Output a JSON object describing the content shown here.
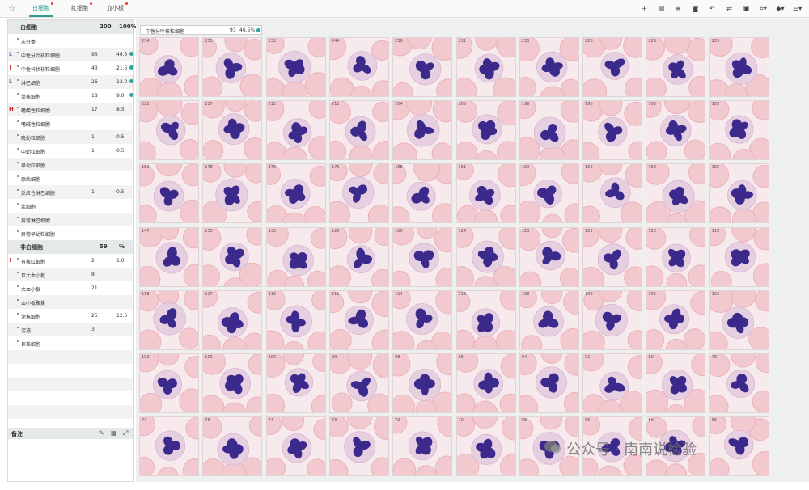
{
  "tabs": [
    {
      "label": "白细胞",
      "active": true
    },
    {
      "label": "红细胞",
      "active": false
    },
    {
      "label": "血小板",
      "active": false
    }
  ],
  "toolbar_icons": [
    "add-icon",
    "copy-icon",
    "sort-icon",
    "camera-icon",
    "undo-icon",
    "compare-icon",
    "bookmark-icon",
    "crop-icon",
    "filter-icon",
    "menu-icon"
  ],
  "wbc_table": {
    "header": {
      "name": "白细胞",
      "count": "200",
      "percent": "100%"
    },
    "rows": [
      {
        "flag": "",
        "name": "未分类",
        "count": "",
        "percent": "",
        "dot": false
      },
      {
        "flag": "L",
        "name": "中性分叶核粒细胞",
        "count": "93",
        "percent": "46.5",
        "dot": true
      },
      {
        "flag": "!",
        "name": "中性杆状核粒细胞",
        "count": "43",
        "percent": "21.5",
        "dot": true
      },
      {
        "flag": "L",
        "name": "淋巴细胞",
        "count": "26",
        "percent": "13.0",
        "dot": true
      },
      {
        "flag": "",
        "name": "单核细胞",
        "count": "18",
        "percent": "9.0",
        "dot": true
      },
      {
        "flag": "H",
        "name": "嗜酸性粒细胞",
        "count": "17",
        "percent": "8.5",
        "dot": false
      },
      {
        "flag": "",
        "name": "嗜碱性粒细胞",
        "count": "",
        "percent": "",
        "dot": false
      },
      {
        "flag": "",
        "name": "晚幼粒细胞",
        "count": "1",
        "percent": "0.5",
        "dot": false
      },
      {
        "flag": "",
        "name": "中幼粒细胞",
        "count": "1",
        "percent": "0.5",
        "dot": false
      },
      {
        "flag": "",
        "name": "早幼粒细胞",
        "count": "",
        "percent": "",
        "dot": false
      },
      {
        "flag": "",
        "name": "原始细胞",
        "count": "",
        "percent": "",
        "dot": false
      },
      {
        "flag": "",
        "name": "反应性淋巴细胞",
        "count": "1",
        "percent": "0.5",
        "dot": false
      },
      {
        "flag": "",
        "name": "浆细胞",
        "count": "",
        "percent": "",
        "dot": false
      },
      {
        "flag": "",
        "name": "异常淋巴细胞",
        "count": "",
        "percent": "",
        "dot": false
      },
      {
        "flag": "",
        "name": "异常早幼粒细胞",
        "count": "",
        "percent": "",
        "dot": false
      }
    ]
  },
  "non_wbc_table": {
    "header": {
      "name": "非白细胞",
      "count": "59",
      "percent": "%"
    },
    "rows": [
      {
        "flag": "!",
        "name": "有核红细胞",
        "count": "2",
        "percent": "1.0"
      },
      {
        "flag": "",
        "name": "巨大血小板",
        "count": "8",
        "percent": ""
      },
      {
        "flag": "",
        "name": "大血小板",
        "count": "21",
        "percent": ""
      },
      {
        "flag": "",
        "name": "血小板聚集",
        "count": "",
        "percent": ""
      },
      {
        "flag": "",
        "name": "涂抹细胞",
        "count": "25",
        "percent": "12.5"
      },
      {
        "flag": "",
        "name": "污迹",
        "count": "3",
        "percent": ""
      },
      {
        "flag": "",
        "name": "巨核细胞",
        "count": "",
        "percent": ""
      }
    ]
  },
  "notes": {
    "label": "备注"
  },
  "selected_tag": {
    "name": "中性分叶核粒细胞",
    "count": "93",
    "percent": "46.5%"
  },
  "cell_numbers": [
    "234",
    "233",
    "232",
    "244",
    "239",
    "231",
    "230",
    "228",
    "226",
    "225",
    "222",
    "217",
    "212",
    "211",
    "204",
    "203",
    "199",
    "196",
    "193",
    "183",
    "182",
    "178",
    "176",
    "175",
    "168",
    "161",
    "160",
    "159",
    "158",
    "155",
    "147",
    "135",
    "132",
    "128",
    "125",
    "124",
    "123",
    "121",
    "120",
    "119",
    "118",
    "117",
    "116",
    "111",
    "114",
    "113",
    "108",
    "109",
    "105",
    "103",
    "102",
    "101",
    "100",
    "99",
    "98",
    "96",
    "94",
    "91",
    "80",
    "79",
    "77",
    "76",
    "74",
    "73",
    "72",
    "70",
    "68",
    "65",
    "59",
    "56"
  ],
  "watermark": "公众号 · 南南说检验",
  "colors": {
    "accent": "#2a9d8f",
    "dot": "#26a69a",
    "flag_low": "#1e5aa8",
    "flag_high": "#d32f2f",
    "nucleus": "#3b2a8c",
    "cytoplasm": "#e7cfe2",
    "rbc": "#f1c9cf"
  }
}
